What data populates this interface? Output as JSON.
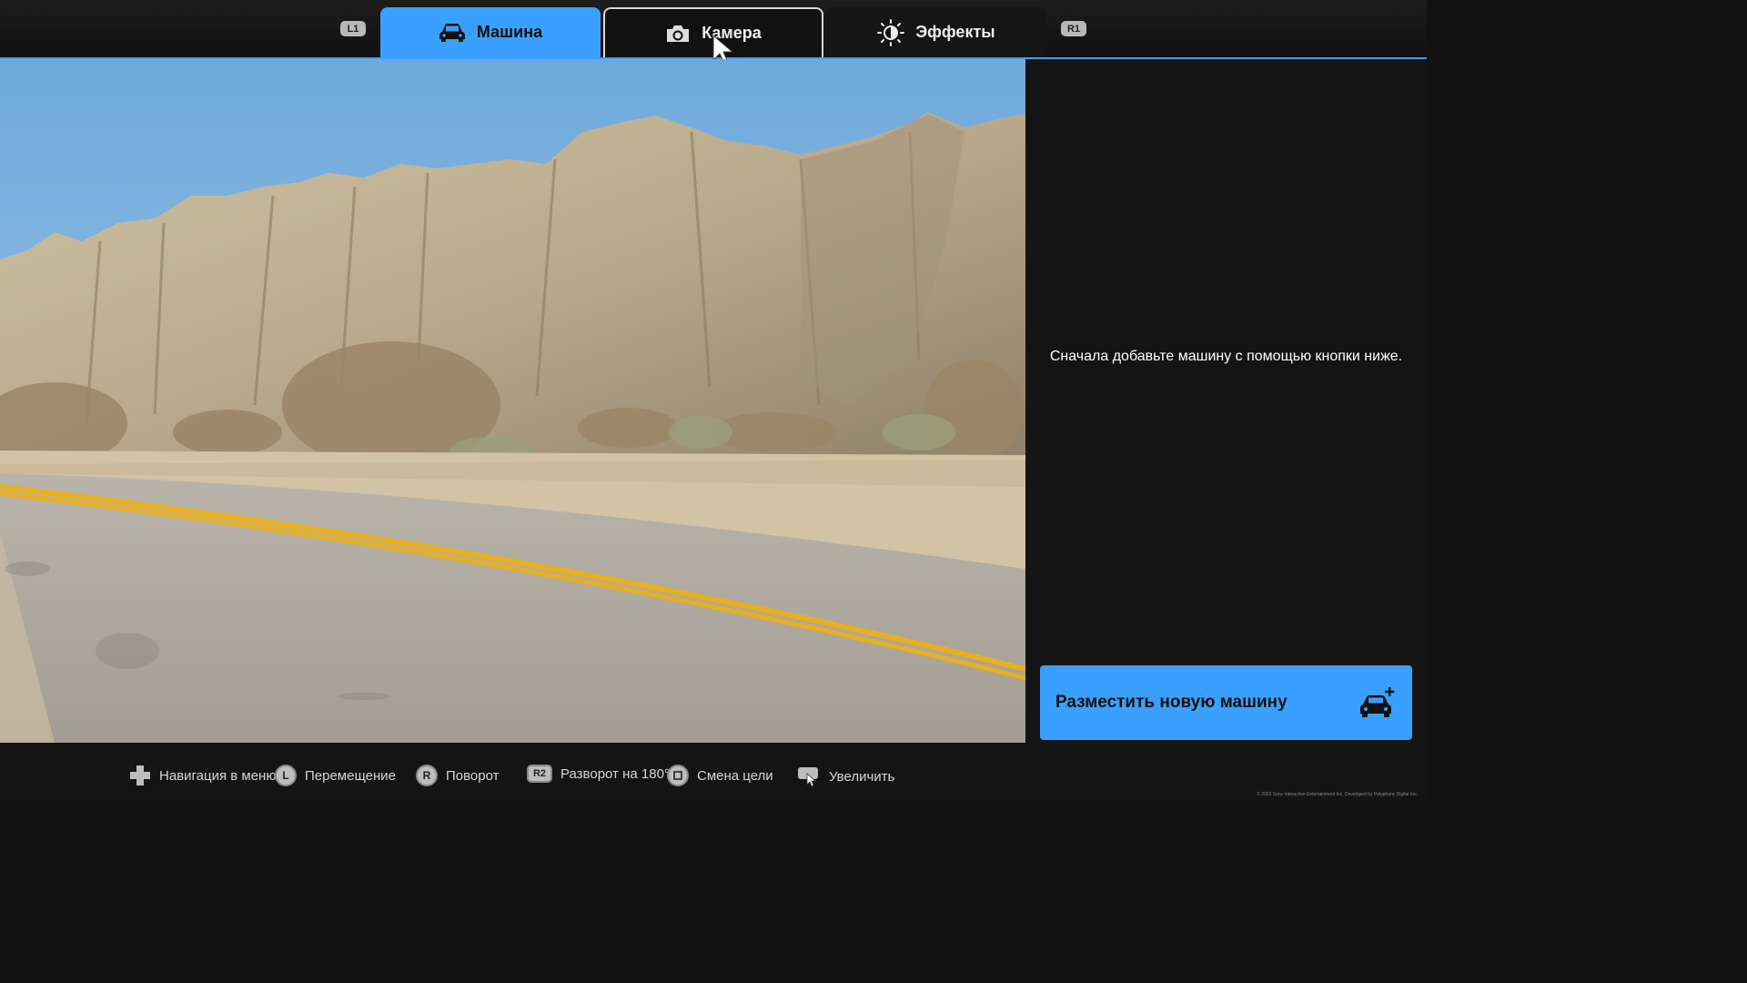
{
  "tabs": {
    "left_shoulder": "L1",
    "right_shoulder": "R1",
    "items": [
      {
        "label": "Машина",
        "icon": "car-icon",
        "state": "active"
      },
      {
        "label": "Камера",
        "icon": "camera-icon",
        "state": "hover"
      },
      {
        "label": "Эффекты",
        "icon": "brightness-icon",
        "state": "normal"
      }
    ]
  },
  "panel": {
    "message": "Сначала добавьте машину с помощью кнопки ниже.",
    "place_button_label": "Разместить новую машину",
    "place_button_icon": "add-car-icon"
  },
  "hints": [
    {
      "glyph": "",
      "icon": "dpad-icon",
      "label": "Навигация в меню"
    },
    {
      "glyph": "L",
      "icon": "left-stick-icon",
      "label": "Перемещение"
    },
    {
      "glyph": "R",
      "icon": "right-stick-icon",
      "label": "Поворот"
    },
    {
      "glyph": "R2",
      "icon": "r2-button-icon",
      "label": "Разворот на 180°"
    },
    {
      "glyph": "",
      "icon": "square-button-icon",
      "label": "Смена цели"
    },
    {
      "glyph": "",
      "icon": "touchpad-icon",
      "label": "Увеличить"
    }
  ],
  "copyright": "© 2023 Sony Interactive Entertainment Inc. Developed by Polyphony Digital Inc.",
  "colors": {
    "accent": "#3aa0ff",
    "panel": "#141414",
    "road_line": "#e8b020"
  }
}
